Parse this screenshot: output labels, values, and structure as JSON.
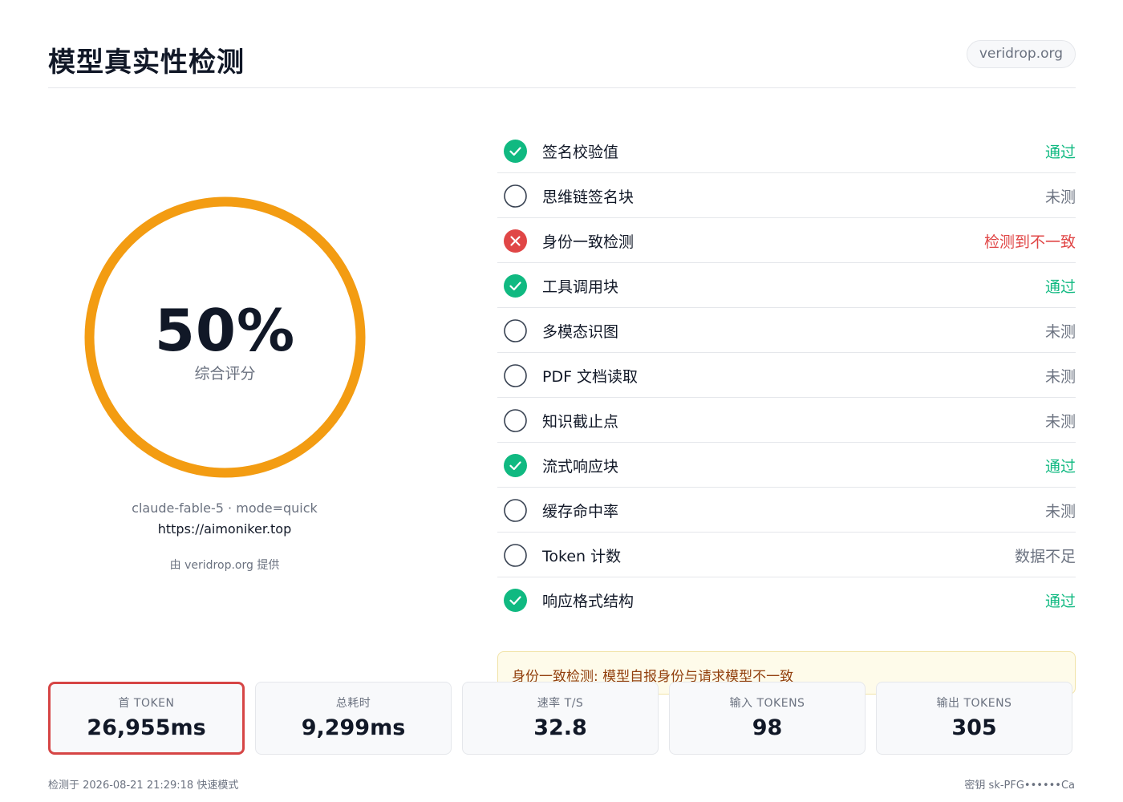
{
  "header": {
    "title": "模型真实性检测",
    "domain": "veridrop.org"
  },
  "summary": {
    "score": "50%",
    "score_label": "综合评分",
    "score_fraction": 0.5,
    "ring_color": "#f39c12",
    "model_line": "claude-fable-5 · mode=quick",
    "url": "https://aimoniker.top",
    "powered_by": "由 veridrop.org 提供"
  },
  "checks": [
    {
      "label": "签名校验值",
      "status": "pass",
      "result": "通过",
      "icon": "check-circle-icon"
    },
    {
      "label": "思维链签名块",
      "status": "none",
      "result": "未测",
      "icon": "empty-circle-icon"
    },
    {
      "label": "身份一致检测",
      "status": "fail",
      "result": "检测到不一致",
      "icon": "x-circle-icon"
    },
    {
      "label": "工具调用块",
      "status": "pass",
      "result": "通过",
      "icon": "check-circle-icon"
    },
    {
      "label": "多模态识图",
      "status": "none",
      "result": "未测",
      "icon": "empty-circle-icon"
    },
    {
      "label": "PDF 文档读取",
      "status": "none",
      "result": "未测",
      "icon": "empty-circle-icon"
    },
    {
      "label": "知识截止点",
      "status": "none",
      "result": "未测",
      "icon": "empty-circle-icon"
    },
    {
      "label": "流式响应块",
      "status": "pass",
      "result": "通过",
      "icon": "check-circle-icon"
    },
    {
      "label": "缓存命中率",
      "status": "none",
      "result": "未测",
      "icon": "empty-circle-icon"
    },
    {
      "label": "Token 计数",
      "status": "none",
      "result": "数据不足",
      "icon": "empty-circle-icon"
    },
    {
      "label": "响应格式结构",
      "status": "pass",
      "result": "通过",
      "icon": "check-circle-icon"
    }
  ],
  "warning": "身份一致检测: 模型自报身份与请求模型不一致",
  "stats": [
    {
      "label": "首 TOKEN",
      "value": "26,955ms",
      "highlight": true
    },
    {
      "label": "总耗时",
      "value": "9,299ms",
      "highlight": false
    },
    {
      "label": "速率 T/S",
      "value": "32.8",
      "highlight": false
    },
    {
      "label": "输入 TOKENS",
      "value": "98",
      "highlight": false
    },
    {
      "label": "输出 TOKENS",
      "value": "305",
      "highlight": false
    }
  ],
  "footer": {
    "left": "检测于 2026-08-21 21:29:18 快速模式",
    "right": "密钥 sk-PFG••••••Ca"
  },
  "colors": {
    "pass": "#10b981",
    "fail": "#e04646",
    "ring": "#f39c12"
  }
}
